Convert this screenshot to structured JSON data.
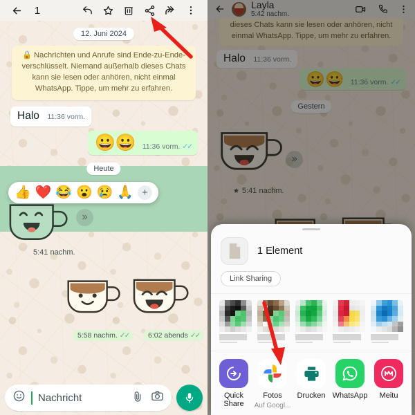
{
  "left_panel": {
    "toolbar": {
      "back_icon": "arrow-left-icon",
      "selected_count": "1",
      "reply_icon": "reply-arrow-icon",
      "star_icon": "star-outline-icon",
      "delete_icon": "trash-icon",
      "share_icon": "share-nodes-icon",
      "forward_icon": "forward-double-arrow-icon",
      "overflow_icon": "more-vertical-icon"
    },
    "date_chip": "12. Juni 2024",
    "e2e_notice": "🔒 Nachrichten und Anrufe sind Ende-zu-Ende-verschlüsselt. Niemand außerhalb dieses Chats kann sie lesen oder anhören, nicht einmal WhatsApp. Tippe, um mehr zu erfahren.",
    "messages": [
      {
        "text": "Halo",
        "time": "11:36 vorm.",
        "direction": "in"
      },
      {
        "text": "😀😀",
        "time": "11:36 vorm.",
        "direction": "out",
        "ticks": "✓✓"
      }
    ],
    "day_divider": "Heute",
    "reactions": [
      "👍",
      "❤️",
      "😂",
      "😮",
      "😢",
      "🙏"
    ],
    "reaction_add": "+",
    "selected_sticker_time": "5:41 nachm.",
    "sticker_times": [
      {
        "time": "5:58 nachm.",
        "ticks": "✓✓"
      },
      {
        "time": "6:02 abends",
        "ticks": "✓✓"
      }
    ],
    "input": {
      "emoji_icon": "emoji-smiley-icon",
      "placeholder": "Nachricht",
      "attach_icon": "paperclip-icon",
      "camera_icon": "camera-icon",
      "mic_icon": "microphone-icon"
    }
  },
  "right_panel": {
    "header": {
      "back_icon": "arrow-left-icon",
      "contact_name": "Layla",
      "status": "5:42 nachm.",
      "video_icon": "video-camera-icon",
      "call_icon": "phone-icon",
      "overflow_icon": "more-vertical-icon"
    },
    "e2e_notice": "dieses Chats kann sie lesen oder anhören, nicht einmal WhatsApp. Tippe, um mehr zu erfahren.",
    "messages": [
      {
        "text": "Halo",
        "time": "11:36 vorm.",
        "direction": "in"
      },
      {
        "text": "😀😀",
        "time": "11:36 vorm.",
        "direction": "out",
        "ticks": "✓✓"
      }
    ],
    "day_divider": "Gestern",
    "starred_time": "5:41 nachm.",
    "star_icon": "star-filled-icon",
    "share_sheet": {
      "file_icon": "document-file-icon",
      "item_count": "1 Element",
      "link_sharing_chip": "Link Sharing",
      "apps": [
        {
          "label": "Quick Share",
          "sub": "",
          "icon": "quick-share-icon",
          "color": "#6e5fd6"
        },
        {
          "label": "Fotos",
          "sub": "Auf Googl...",
          "icon": "google-photos-icon",
          "color": "#ffffff"
        },
        {
          "label": "Drucken",
          "sub": "",
          "icon": "printer-icon",
          "color": "#ffffff"
        },
        {
          "label": "WhatsApp",
          "sub": "",
          "icon": "whatsapp-icon",
          "color": "#25d366"
        },
        {
          "label": "Meitu",
          "sub": "",
          "icon": "meitu-icon",
          "color": "#f0295e"
        }
      ]
    }
  },
  "annotations": {
    "arrow_left_label": "red-arrow-pointing-to-share-icon",
    "arrow_right_label": "red-arrow-pointing-to-fotos-app"
  },
  "colors": {
    "outgoing_bubble": "#d9fdd3",
    "wallpaper": "#f5ede3",
    "e2e_note": "#fdf4d3",
    "selection": "#a9d6b6",
    "accent_green": "#00a884",
    "tick_blue": "#53bdeb",
    "arrow_red": "#e8201a"
  }
}
